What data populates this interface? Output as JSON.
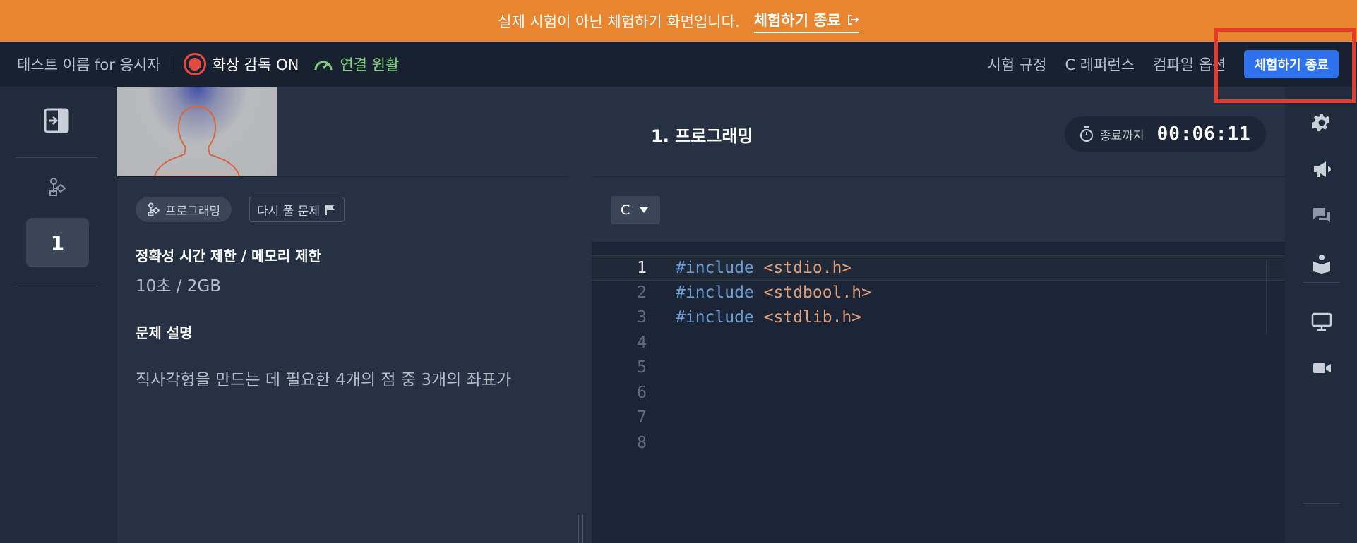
{
  "banner": {
    "message": "실제 시험이 아닌 체험하기 화면입니다.",
    "end_link": "체험하기 종료"
  },
  "header": {
    "test_name": "테스트 이름 for 응시자",
    "proctor_status": "화상 감독 ON",
    "connection_status": "연결 원활",
    "links": [
      "시험 규정",
      "C 레퍼런스",
      "컴파일 옵션"
    ],
    "end_button": "체험하기 종료"
  },
  "sidebar": {
    "problem_number": "1"
  },
  "problem": {
    "title": "1. 프로그래밍",
    "type_chip": "프로그래밍",
    "retry_chip": "다시 풀 문제",
    "limits_title": "정확성 시간 제한 / 메모리 제한",
    "limits_value": "10초 / 2GB",
    "desc_title": "문제 설명",
    "desc_text": "직사각형을 만드는 데 필요한 4개의 점 중 3개의 좌표가"
  },
  "timer": {
    "label": "종료까지",
    "value": "00:06:11"
  },
  "editor": {
    "language": "C",
    "lines": [
      {
        "num": "1",
        "directive": "#include",
        "header": "<stdio.h>"
      },
      {
        "num": "2",
        "directive": "#include",
        "header": "<stdbool.h>"
      },
      {
        "num": "3",
        "directive": "#include",
        "header": "<stdlib.h>"
      },
      {
        "num": "4",
        "directive": "",
        "header": ""
      },
      {
        "num": "5",
        "directive": "",
        "header": ""
      },
      {
        "num": "6",
        "directive": "",
        "header": ""
      },
      {
        "num": "7",
        "directive": "",
        "header": ""
      },
      {
        "num": "8",
        "directive": "",
        "header": ""
      }
    ]
  },
  "colors": {
    "banner": "#E8852E",
    "accent_button": "#2F72EE",
    "record_red": "#E34B3E",
    "connection_green": "#7ED17A",
    "highlight_red": "#E8392B"
  },
  "icons": {
    "banner_end": "exit-icon",
    "proctor": "record-icon",
    "connection": "speedometer-icon",
    "timer": "stopwatch-icon",
    "retry": "flag-icon",
    "sidebar_collapse": "panel-collapse-icon",
    "program_type": "flowchart-icon",
    "right_sidebar": [
      "gear-icon",
      "megaphone-icon",
      "chat-icon",
      "book-icon",
      "monitor-icon",
      "video-camera-icon"
    ]
  }
}
